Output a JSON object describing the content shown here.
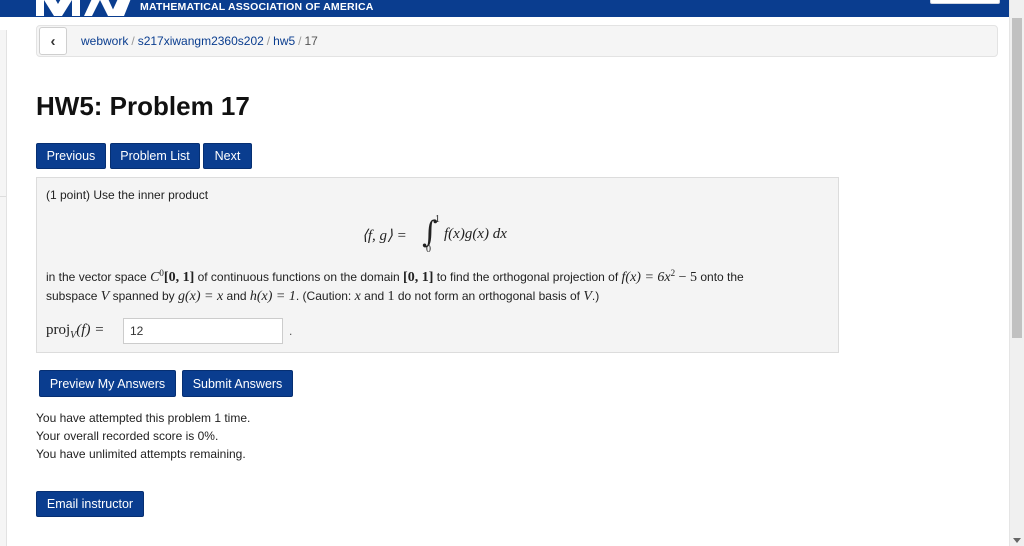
{
  "header": {
    "brand_text": "MATHEMATICAL ASSOCIATION OF AMERICA",
    "logo_icon": "maa-logo-icon",
    "bar_color": "#0a3d8f"
  },
  "breadcrumb": {
    "back_icon": "chevron-left-icon",
    "back_glyph": "‹",
    "items": [
      "webwork",
      "s217xiwangm2360s202",
      "hw5",
      "17"
    ],
    "separator": "/"
  },
  "page": {
    "title": "HW5: Problem 17"
  },
  "nav_buttons": {
    "previous": "Previous",
    "problem_list": "Problem List",
    "next": "Next"
  },
  "problem": {
    "intro": "(1 point) Use the inner product",
    "formula": {
      "lhs": "⟨f, g⟩ =",
      "integral_sign": "∫",
      "upper": "1",
      "lower": "0",
      "integrand": "f(x)g(x) dx"
    },
    "text_parts": {
      "t1": "in the vector space ",
      "space": "C",
      "space_sup": "0",
      "interval1": "[0, 1]",
      "t2": " of continuous functions on the domain ",
      "interval2": "[0, 1]",
      "t3": " to find the orthogonal projection of ",
      "f_def": "f(x) = 6x",
      "f_exp": "2",
      "f_tail": " − 5",
      "t4": " onto the",
      "t5": "subspace ",
      "V": "V",
      "t6": " spanned by ",
      "g_def": "g(x) = x",
      "t7": " and ",
      "h_def": "h(x) = 1",
      "t8": ". (Caution: ",
      "x": "x",
      "t9": " and ",
      "one": "1",
      "t10": " do not form an orthogonal basis of ",
      "V2": "V",
      "t11": ".)"
    },
    "proj_label": "proj",
    "proj_sub": "V",
    "proj_arg": "(f) =",
    "answer_value": "12",
    "trailing_dot": "."
  },
  "action_buttons": {
    "preview": "Preview My Answers",
    "submit": "Submit Answers"
  },
  "status": {
    "line1": "You have attempted this problem 1 time.",
    "line2": "Your overall recorded score is 0%.",
    "line3": "You have unlimited attempts remaining."
  },
  "email_button": "Email instructor"
}
